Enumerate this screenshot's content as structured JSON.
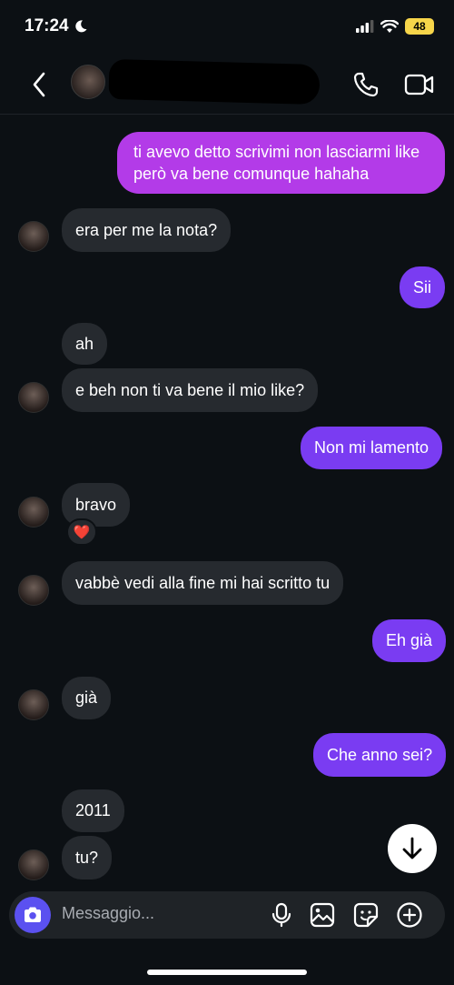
{
  "status": {
    "time": "17:24",
    "battery": "48"
  },
  "header": {
    "contact_name": ""
  },
  "messages": [
    {
      "dir": "out",
      "text": "ti avevo detto scrivimi non lasciarmi like però va bene comunque hahaha"
    },
    {
      "dir": "in",
      "text": "era per me la nota?"
    },
    {
      "dir": "out",
      "text": "Sii"
    },
    {
      "dir": "in",
      "text": "ah"
    },
    {
      "dir": "in",
      "text": "e beh non ti va bene il mio like?"
    },
    {
      "dir": "out",
      "text": "Non mi lamento"
    },
    {
      "dir": "in",
      "text": "bravo",
      "reaction": "❤️"
    },
    {
      "dir": "in",
      "text": "vabbè vedi alla fine mi hai scritto tu"
    },
    {
      "dir": "out",
      "text": "Eh già"
    },
    {
      "dir": "in",
      "text": "già"
    },
    {
      "dir": "out",
      "text": "Che anno sei?"
    },
    {
      "dir": "in",
      "text": "2011"
    },
    {
      "dir": "in",
      "text": "tu?"
    }
  ],
  "composer": {
    "placeholder": "Messaggio..."
  },
  "colors": {
    "outgoing_top": "#b33be8",
    "outgoing": "#7a3cf2",
    "incoming": "#262a2f",
    "background": "#0c1014",
    "camera": "#5b51f0"
  },
  "icons": [
    "moon-icon",
    "signal-icon",
    "wifi-icon",
    "battery-icon",
    "back-chevron-icon",
    "phone-icon",
    "video-camera-icon",
    "arrow-down-icon",
    "camera-icon",
    "microphone-icon",
    "gallery-icon",
    "sticker-icon",
    "plus-circle-icon",
    "heart-icon"
  ]
}
